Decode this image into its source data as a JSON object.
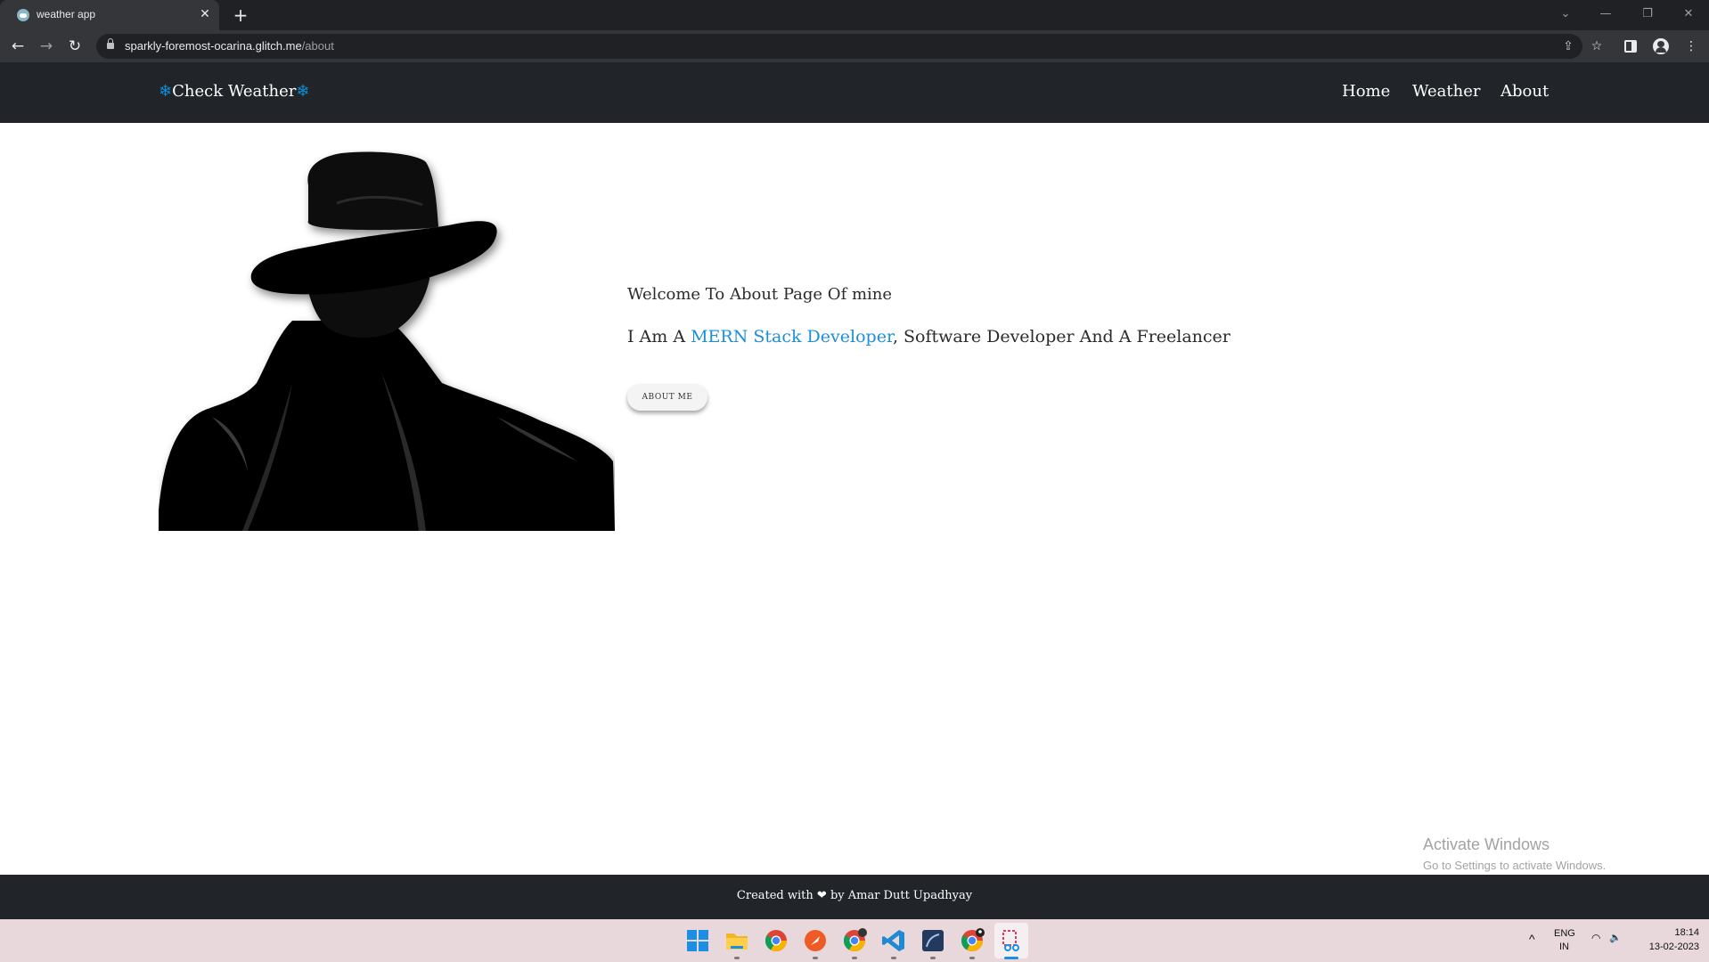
{
  "browser": {
    "tab_title": "weather app",
    "close_glyph": "✕",
    "newtab_glyph": "+",
    "url_host": "sparkly-foremost-ocarina.glitch.me",
    "url_path": "/about",
    "icons": {
      "back": "←",
      "forward": "→",
      "reload": "↻",
      "share": "⇪",
      "star": "☆",
      "menu": "⋮",
      "chevron": "⌄",
      "minimize": "—",
      "restore": "❐",
      "close": "✕"
    }
  },
  "navbar": {
    "brand_text": "Check Weather",
    "snow_glyph": "❄",
    "links": [
      "Home",
      "Weather",
      "About"
    ]
  },
  "main": {
    "welcome": "Welcome To About Page Of mine",
    "intro_prefix": "I Am A ",
    "intro_highlight": "MERN Stack Developer",
    "intro_suffix": ", Software Developer And A Freelancer",
    "button_label": "ABOUT ME",
    "image_alt": "silhouette of a man in a fedora and coat"
  },
  "watermark": {
    "title": "Activate Windows",
    "subtitle": "Go to Settings to activate Windows."
  },
  "footer": {
    "prefix": "Created with ",
    "heart": "❤",
    "suffix": " by Amar Dutt Upadhyay"
  },
  "taskbar": {
    "apps": [
      "start-menu",
      "file-explorer",
      "chrome",
      "postman",
      "chrome-profile",
      "vs-code",
      "mysql-workbench",
      "chrome-profile-2",
      "snipping-tool"
    ],
    "tray_chevron": "^",
    "lang_top": "ENG",
    "lang_bottom": "IN",
    "wifi_glyph": "◠",
    "volume_glyph": "🔈",
    "time": "18:14",
    "date": "13-02-2023"
  },
  "colors": {
    "navbar_bg": "#212529",
    "accent_blue": "#1d8ed8",
    "page_bg": "#ffffff"
  }
}
